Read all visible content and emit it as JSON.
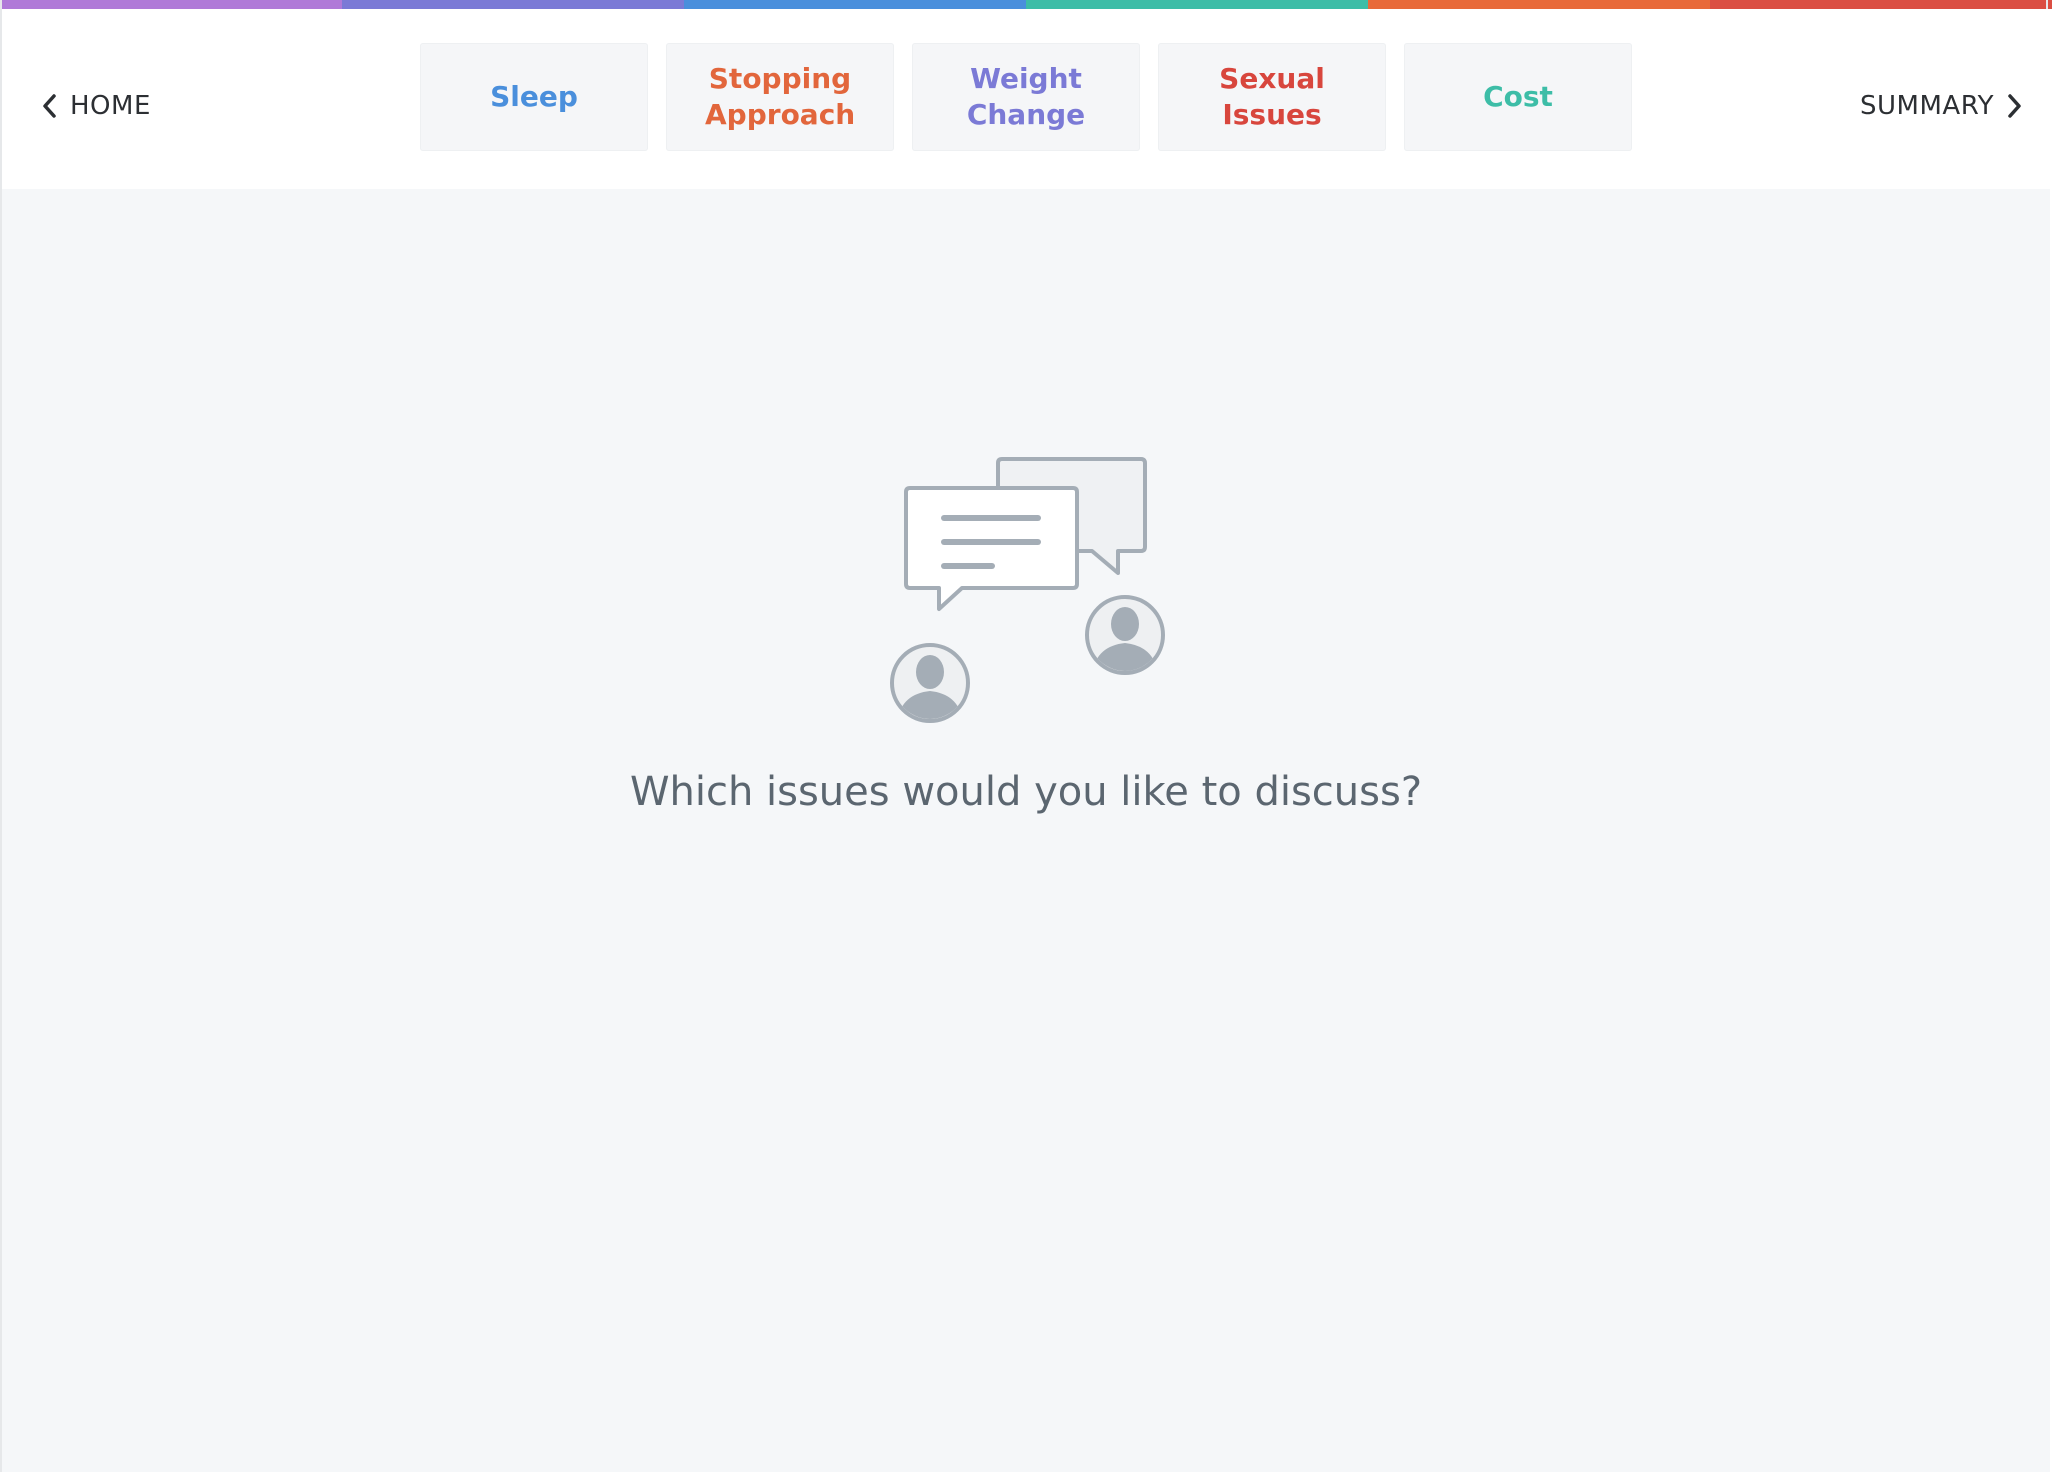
{
  "colors": {
    "strip": [
      "#b07ad8",
      "#7b7ad6",
      "#4a8fdc",
      "#3dbda7",
      "#e86a3a",
      "#db4e43"
    ],
    "text_dark": "#2c2f33",
    "illustration_stroke": "#a4adb6"
  },
  "nav": {
    "home_label": "HOME",
    "summary_label": "SUMMARY",
    "home_icon": "chevron-left-icon",
    "summary_icon": "chevron-right-icon"
  },
  "tabs": [
    {
      "label": "Sleep",
      "color": "#4a8fdc"
    },
    {
      "label": "Stopping Approach",
      "color": "#e2663c"
    },
    {
      "label": "Weight Change",
      "color": "#7b7ad6"
    },
    {
      "label": "Sexual Issues",
      "color": "#d8463d"
    },
    {
      "label": "Cost",
      "color": "#3dbda7"
    }
  ],
  "main": {
    "illustration_icon": "conversation-icon",
    "prompt": "Which issues would you like to discuss?"
  }
}
